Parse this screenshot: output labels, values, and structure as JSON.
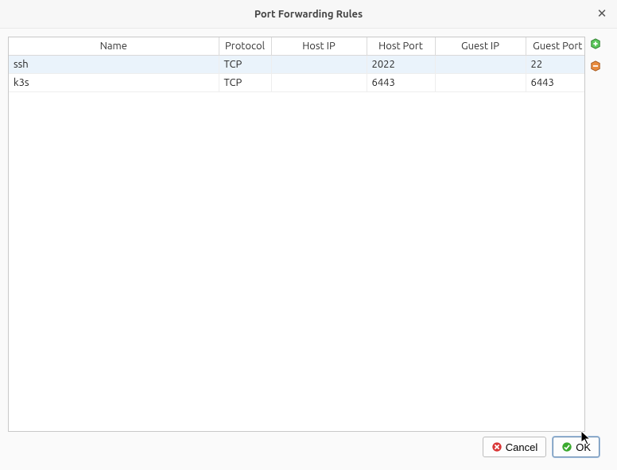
{
  "window": {
    "title": "Port Forwarding Rules"
  },
  "table": {
    "headers": {
      "name": "Name",
      "protocol": "Protocol",
      "host_ip": "Host IP",
      "host_port": "Host Port",
      "guest_ip": "Guest IP",
      "guest_port": "Guest Port"
    },
    "rows": [
      {
        "name": "ssh",
        "protocol": "TCP",
        "host_ip": "",
        "host_port": "2022",
        "guest_ip": "",
        "guest_port": "22",
        "selected": true
      },
      {
        "name": "k3s",
        "protocol": "TCP",
        "host_ip": "",
        "host_port": "6443",
        "guest_ip": "",
        "guest_port": "6443",
        "selected": false
      }
    ]
  },
  "side": {
    "add_icon": "add-rule-icon",
    "remove_icon": "remove-rule-icon"
  },
  "buttons": {
    "cancel": "Cancel",
    "ok": "OK"
  }
}
